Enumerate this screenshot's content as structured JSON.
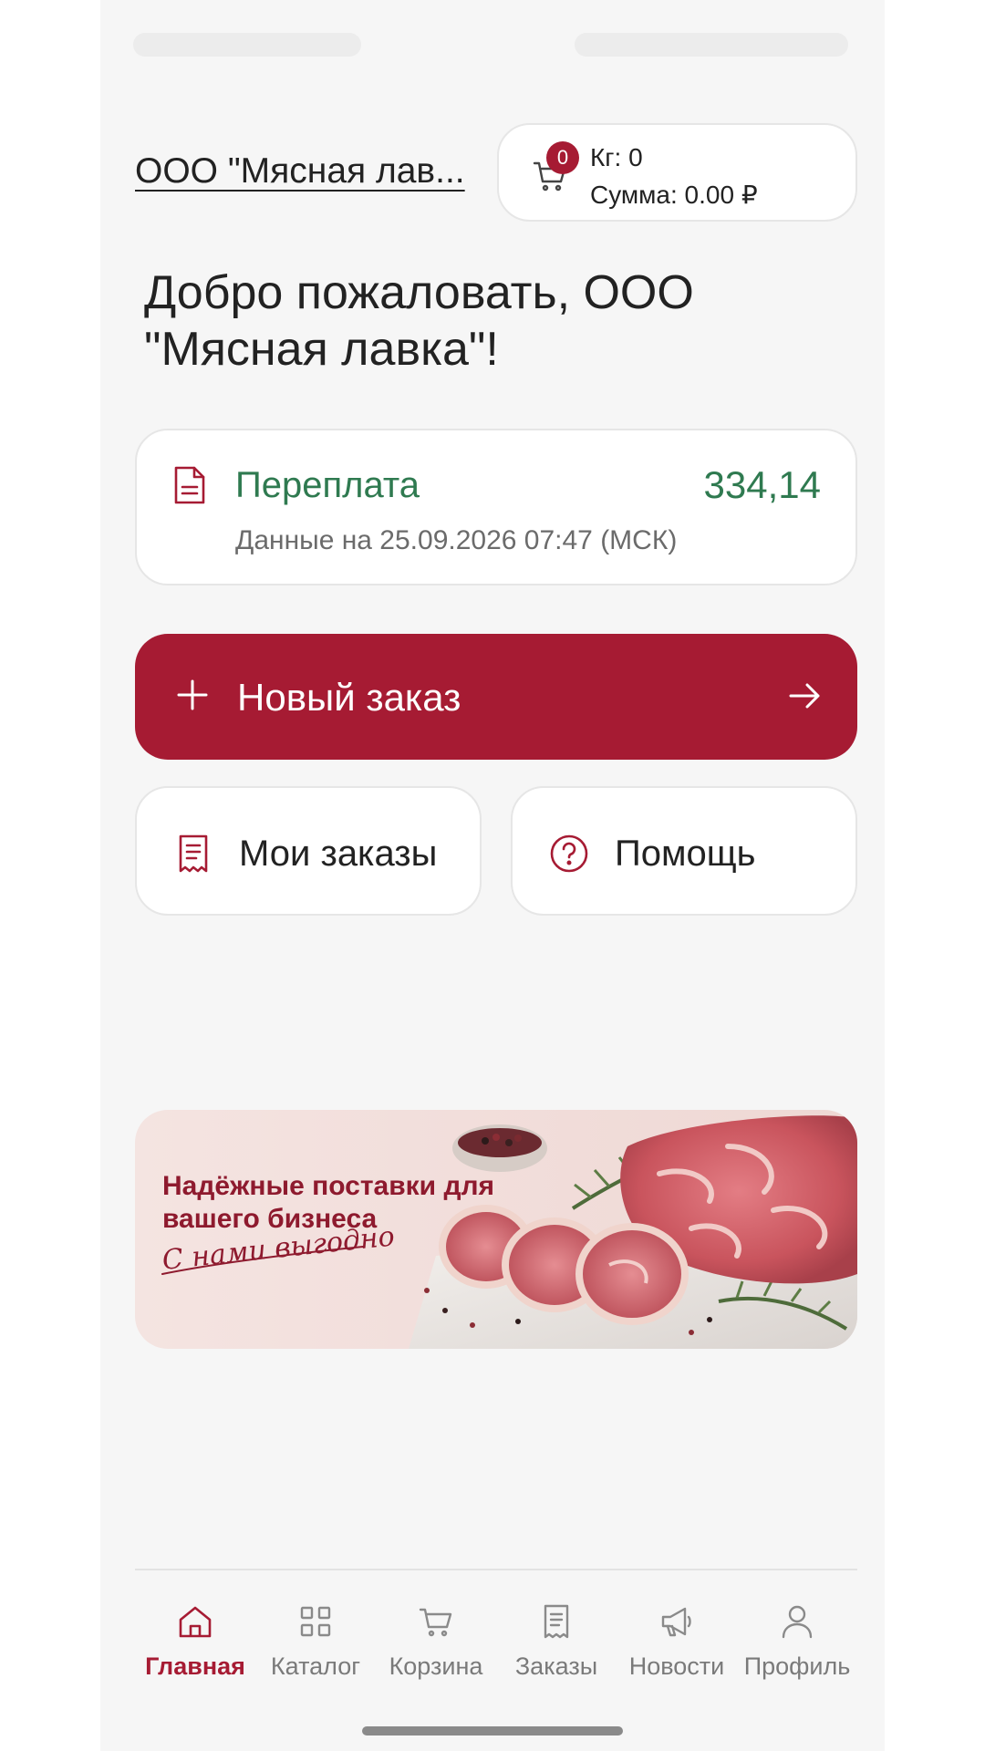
{
  "header": {
    "org_name": "ООО \"Мясная лав...",
    "cart": {
      "badge_count": "0",
      "kg": "Кг: 0",
      "sum": "Сумма: 0.00 ₽"
    }
  },
  "welcome": "Добро пожаловать, ООО \"Мясная лавка\"!",
  "balance": {
    "label": "Переплата",
    "value": "334,14",
    "date": "Данные на 25.09.2026 07:47 (МСК)"
  },
  "actions": {
    "new_order": "Новый заказ",
    "my_orders": "Мои заказы",
    "help": "Помощь"
  },
  "banner": {
    "title": "Надёжные поставки для вашего бизнеса",
    "tagline": "С нами выгодно"
  },
  "tabbar": {
    "items": [
      {
        "label": "Главная",
        "icon": "home-icon",
        "active": true
      },
      {
        "label": "Каталог",
        "icon": "grid-icon"
      },
      {
        "label": "Корзина",
        "icon": "cart-icon"
      },
      {
        "label": "Заказы",
        "icon": "receipt-icon"
      },
      {
        "label": "Новости",
        "icon": "megaphone-icon"
      },
      {
        "label": "Профиль",
        "icon": "user-icon"
      }
    ]
  },
  "colors": {
    "accent": "#a61b33",
    "positive": "#2f7a50",
    "background": "#f6f6f6",
    "card": "#ffffff"
  }
}
